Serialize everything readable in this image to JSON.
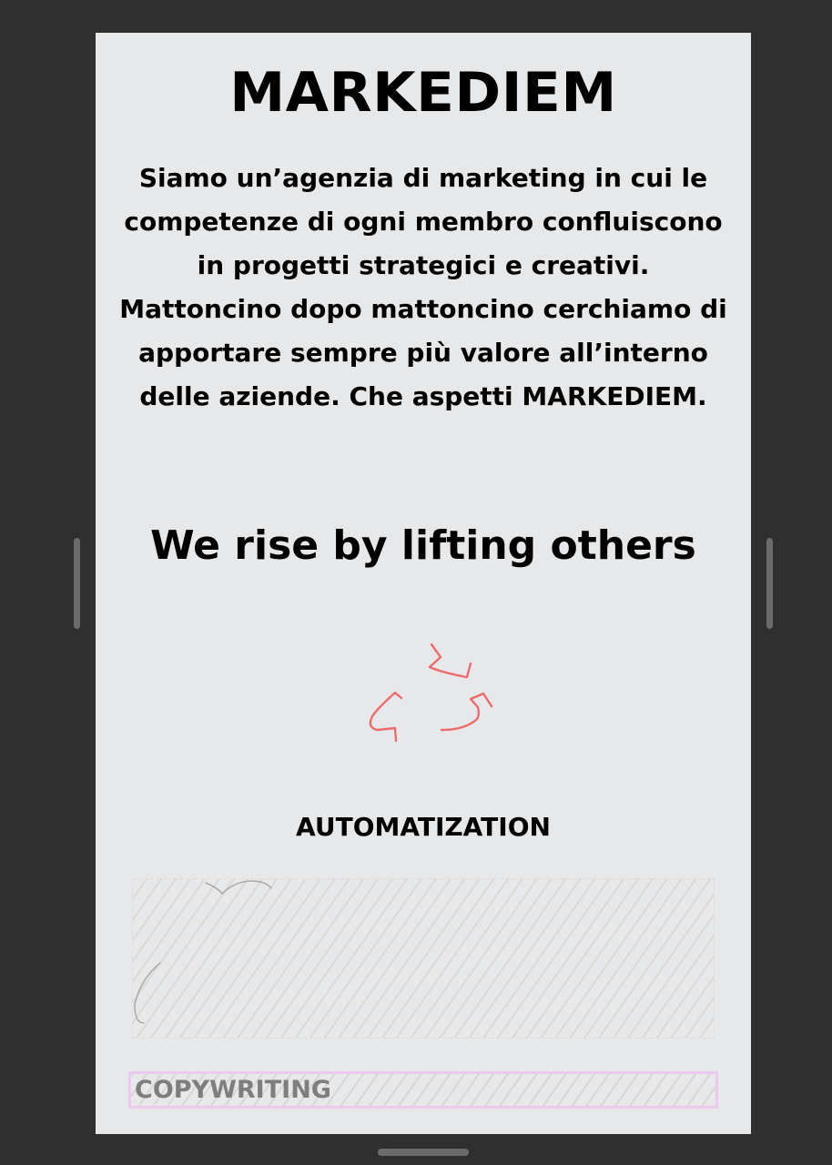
{
  "brand": {
    "title": "MARKEDIEM"
  },
  "intro": {
    "part1": "Siamo un’",
    "highlight": "agenzia di marketing",
    "part2": " in cui le competenze di ogni membro confluiscono in progetti strategici e creativi. Mattoncino dopo mattoncino cerchiamo di apportare sempre più valore all’interno delle aziende. Che aspetti ",
    "brand_inline": "MARKEDIEM",
    "part3": "."
  },
  "slogan": "We rise by lifting others",
  "icons": {
    "recycle": "recycle-icon",
    "placeholder_sketch": "sketch-image"
  },
  "sections": {
    "automatization": {
      "heading": "AUTOMATIZATION"
    },
    "copywriting": {
      "heading": "COPYWRITING"
    }
  },
  "colors": {
    "background": "#2f2f2f",
    "page": "#e7e8ea",
    "text": "#000000",
    "recycle_icon": "#ef6b6b",
    "highlight_border": "#efc7f3",
    "muted_text": "#7e7e7e"
  }
}
